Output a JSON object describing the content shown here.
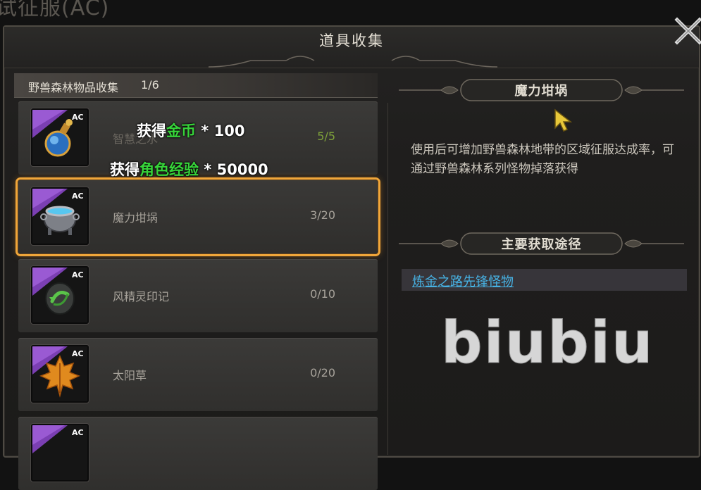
{
  "background_title": "试征服(AC)",
  "panel": {
    "title": "道具收集"
  },
  "list": {
    "header_label": "野兽森林物品收集",
    "header_progress": "1/6",
    "items": [
      {
        "name": "智慧之水",
        "count": "5/5",
        "badge": "AC",
        "icon": "potion-icon",
        "complete": true
      },
      {
        "name": "魔力坩埚",
        "count": "3/20",
        "badge": "AC",
        "icon": "cauldron-icon",
        "selected": true
      },
      {
        "name": "风精灵印记",
        "count": "0/10",
        "badge": "AC",
        "icon": "wind-seal-icon"
      },
      {
        "name": "太阳草",
        "count": "0/20",
        "badge": "AC",
        "icon": "maple-leaf-icon"
      },
      {
        "name": "",
        "count": "",
        "badge": "AC",
        "icon": "item-icon"
      }
    ]
  },
  "rewards": {
    "line1_prefix": "获得",
    "line1_highlight": "金币",
    "line1_suffix": " * 100",
    "line2_prefix": "获得",
    "line2_highlight": "角色经验",
    "line2_suffix": " * 50000"
  },
  "detail": {
    "item_title": "魔力坩埚",
    "description": "使用后可增加野兽森林地带的区域征服达成率，可通过野兽森林系列怪物掉落获得",
    "sources_title": "主要获取途径",
    "source_link": "炼金之路先锋怪物"
  },
  "watermark": "biubiu",
  "colors": {
    "selected_outline": "#f0a63a",
    "complete_count": "#7ea23a",
    "reward_highlight": "#37d43a",
    "link": "#47b2e4"
  }
}
